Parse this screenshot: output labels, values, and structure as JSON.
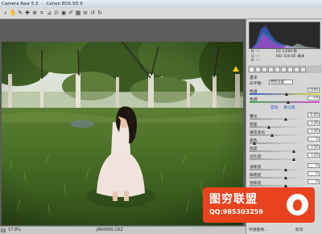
{
  "window": {
    "app_title": "Camera Raw 5.3",
    "camera": "Canon EOS-5D II"
  },
  "toolbar": {
    "tools": [
      "zoom-icon",
      "hand-icon",
      "white-balance-icon",
      "color-sampler-icon",
      "target-adjust-icon",
      "crop-icon",
      "straighten-icon",
      "spot-removal-icon",
      "red-eye-icon",
      "adjustment-brush-icon",
      "graduated-filter-icon",
      "preferences-icon",
      "rotate-left-icon",
      "rotate-right-icon"
    ],
    "glyphs": [
      "⌕",
      "✋",
      "✎",
      "✚",
      "⊕",
      "⌗",
      "⊿",
      "⊙",
      "◉",
      "✐",
      "▦",
      "≡",
      "↺",
      "↻"
    ]
  },
  "readouts": {
    "rgb_labels": [
      "R:",
      "G:",
      "B:"
    ],
    "rgb_values": [
      "---",
      "---",
      "---"
    ],
    "exposure": "f/2   1/200 秒",
    "iso": "ISO 100   85 毫米"
  },
  "panel": {
    "section_basic": "基本",
    "white_balance_label": "白平衡:",
    "white_balance_value": "原照设置",
    "temperature_label": "色温",
    "temperature_value": "5500",
    "tint_label": "色调",
    "tint_value": "+9",
    "auto_link": "自动",
    "default_link": "默认值",
    "rows": [
      {
        "label": "曝光",
        "value": "0.00",
        "pos": 0.5
      },
      {
        "label": "恢复",
        "value": "+26",
        "pos": 0.26
      },
      {
        "label": "填充亮光",
        "value": "+30",
        "pos": 0.3
      },
      {
        "label": "黑色",
        "value": "5",
        "pos": 0.05
      },
      {
        "label": "亮度",
        "value": "+50",
        "pos": 0.62
      },
      {
        "label": "对比度",
        "value": "+25",
        "pos": 0.62
      },
      {
        "label": "清晰度",
        "value": "0",
        "pos": 0.5
      },
      {
        "label": "鲜艳度",
        "value": "0",
        "pos": 0.5
      },
      {
        "label": "饱和度",
        "value": "0",
        "pos": 0.5
      }
    ]
  },
  "status": {
    "zoom": "17.8%",
    "filename": "JRK0905.CR2"
  },
  "buttons": {
    "save": "存储图像...",
    "cancel": "取消"
  },
  "watermark": {
    "title": "图穷联盟",
    "qq": "QQ:985303259",
    "logo_text": "图穷联盟 hanzilianmeng"
  }
}
